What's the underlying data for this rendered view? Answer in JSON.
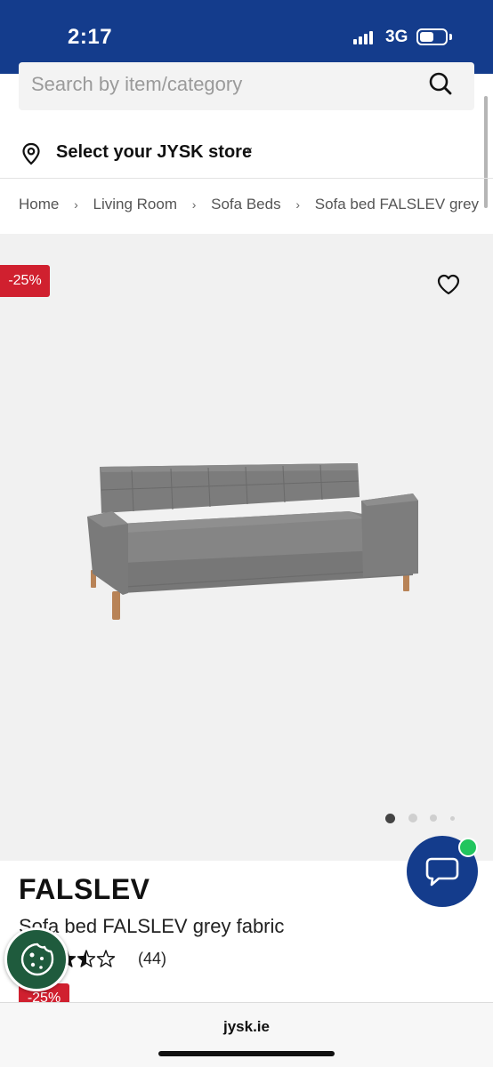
{
  "status_bar": {
    "time": "2:17",
    "network": "3G",
    "battery_level": 0.55
  },
  "search": {
    "placeholder": "Search by item/category",
    "value": ""
  },
  "store": {
    "label": "Select your JYSK store",
    "chevron": "˅"
  },
  "breadcrumb": {
    "separator": "›",
    "items": [
      "Home",
      "Living Room",
      "Sofa Beds",
      "Sofa bed FALSLEV grey fa"
    ]
  },
  "gallery": {
    "discount_label": "-25%",
    "image_alt": "Sofa bed FALSLEV grey fabric",
    "current_image": 1,
    "image_count": 4
  },
  "product": {
    "name": "FALSLEV",
    "subtitle": "Sofa bed FALSLEV grey fabric",
    "rating": 3.5,
    "review_count": "(44)",
    "price_badge": "-25%"
  },
  "browser": {
    "url": "jysk.ie"
  },
  "colors": {
    "brand_blue": "#143c8c",
    "discount_red": "#d0202f",
    "online_green": "#22c55e",
    "cookie_green": "#1f5b3d"
  },
  "icons": {
    "search": "search-icon",
    "pin": "location-pin-icon",
    "heart": "heart-icon",
    "chat": "chat-bubble-icon",
    "cookie": "cookie-icon",
    "star": "star-icon"
  }
}
